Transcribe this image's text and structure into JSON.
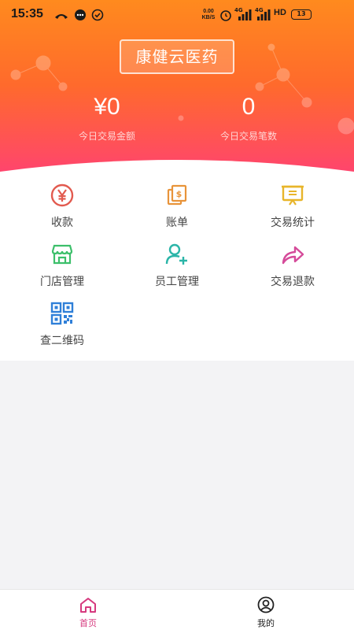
{
  "status_bar": {
    "time": "15:35",
    "net_speed_top": "0.00",
    "net_speed_bottom": "KB/S",
    "signal1_tag": "4G",
    "signal2_tag": "4G",
    "hd_tag": "HD",
    "battery": "13",
    "icons": [
      "phone-missed-icon",
      "message-icon",
      "check-circle-icon",
      "alarm-icon",
      "signal-icon",
      "signal-icon",
      "hd-icon",
      "battery-icon"
    ]
  },
  "header": {
    "store_name": "康健云医药",
    "amount": "¥0",
    "amount_label": "今日交易金额",
    "count": "0",
    "count_label": "今日交易笔数"
  },
  "menu": {
    "items": [
      {
        "label": "收款",
        "icon": "yen-circle-icon",
        "color": "#e25a4f"
      },
      {
        "label": "账单",
        "icon": "bill-icon",
        "color": "#e8943a"
      },
      {
        "label": "交易统计",
        "icon": "statistics-board-icon",
        "color": "#e8b52a"
      },
      {
        "label": "门店管理",
        "icon": "store-icon",
        "color": "#3cbf6a"
      },
      {
        "label": "员工管理",
        "icon": "add-user-icon",
        "color": "#2bb5a8"
      },
      {
        "label": "交易退款",
        "icon": "refund-share-icon",
        "color": "#d54b9a"
      },
      {
        "label": "查二维码",
        "icon": "qr-code-icon",
        "color": "#2f7fd8"
      }
    ]
  },
  "bottom_nav": {
    "home_label": "首页",
    "mine_label": "我的",
    "active_color": "#d6397e",
    "inactive_color": "#222222"
  }
}
